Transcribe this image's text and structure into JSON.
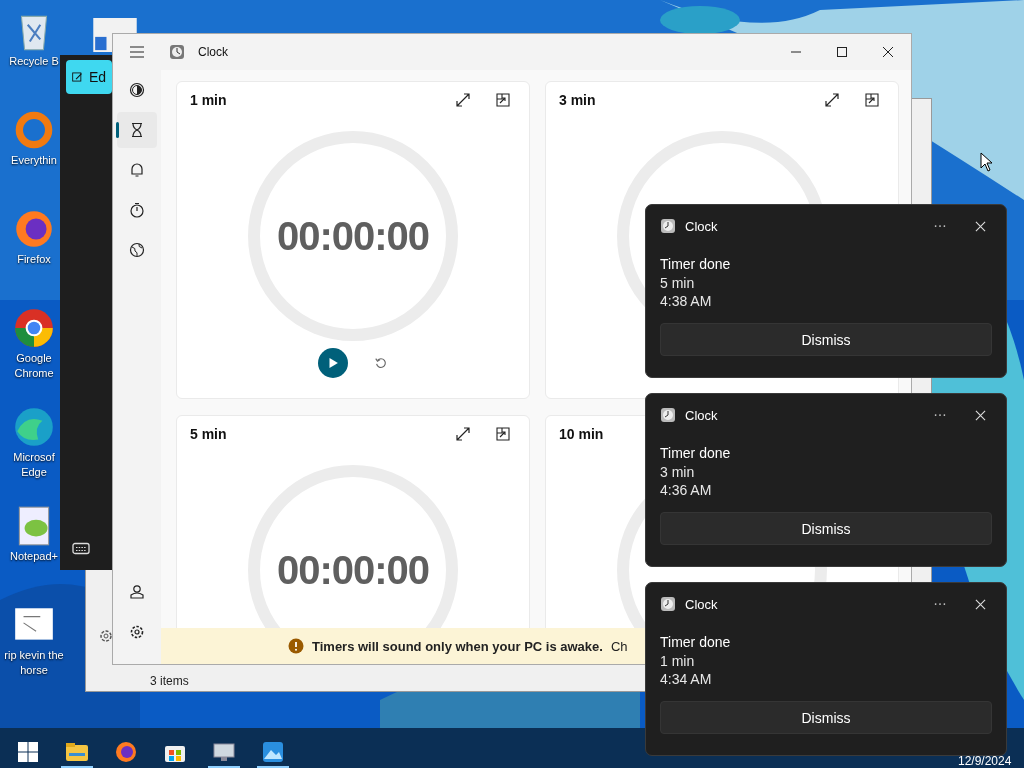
{
  "desktop_icons": [
    {
      "kind": "recycle",
      "label": "Recycle B"
    },
    {
      "kind": "ring",
      "label": "Everythin"
    },
    {
      "kind": "firefox",
      "label": "Firefox"
    },
    {
      "kind": "chrome",
      "label": "Google Chrome"
    },
    {
      "kind": "edge",
      "label": "Microsof Edge"
    },
    {
      "kind": "notepad",
      "label": "Notepad+"
    },
    {
      "kind": "sketch",
      "label": "rip kevin the horse"
    }
  ],
  "back_window": {
    "button": "Ed",
    "status": "3 items"
  },
  "window": {
    "title": "Clock"
  },
  "nav": {
    "items": [
      {
        "kind": "focus",
        "selected": false
      },
      {
        "kind": "timer",
        "selected": true
      },
      {
        "kind": "alarm",
        "selected": false
      },
      {
        "kind": "stopwatch",
        "selected": false
      },
      {
        "kind": "world",
        "selected": false
      }
    ],
    "footer": [
      {
        "kind": "account"
      },
      {
        "kind": "settings"
      }
    ]
  },
  "timers": [
    {
      "label": "1 min",
      "time": "00:00:00",
      "actions": true,
      "controls": true
    },
    {
      "label": "3 min",
      "actions": true
    },
    {
      "label": "5 min",
      "time": "00:00:00",
      "actions": true
    },
    {
      "label": "10 min"
    }
  ],
  "banner": {
    "text": "Timers will sound only when your PC is awake.",
    "link": "Ch"
  },
  "notifications": [
    {
      "app": "Clock",
      "title": "Timer done",
      "name": "5 min",
      "time": "4:38 AM",
      "button": "Dismiss"
    },
    {
      "app": "Clock",
      "title": "Timer done",
      "name": "3 min",
      "time": "4:36 AM",
      "button": "Dismiss"
    },
    {
      "app": "Clock",
      "title": "Timer done",
      "name": "1 min",
      "time": "4:34 AM",
      "button": "Dismiss"
    }
  ],
  "taskbar": {
    "apps": [
      {
        "kind": "start",
        "running": false
      },
      {
        "kind": "explorer",
        "running": true
      },
      {
        "kind": "firefox",
        "running": false
      },
      {
        "kind": "store",
        "running": false
      },
      {
        "kind": "monitor",
        "running": true
      },
      {
        "kind": "photos",
        "running": true
      }
    ],
    "date": "12/9/2024"
  }
}
